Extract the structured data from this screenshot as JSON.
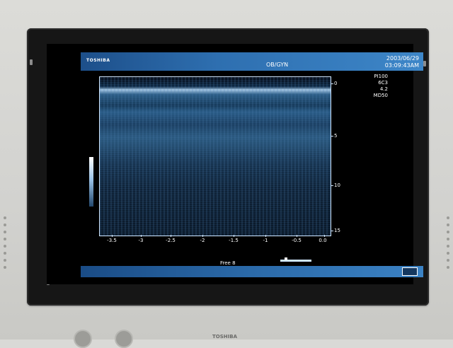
{
  "device": {
    "brand_top": "TOSHIBA",
    "exam_preset": "OB/GYN",
    "date": "2003/06/29",
    "time": "03:09:43AM",
    "params": [
      "PI100",
      "6C3",
      "4.2",
      "MD50"
    ]
  },
  "scale": {
    "depth_labels": [
      "0",
      "5",
      "10",
      "15"
    ],
    "x_labels": [
      "-3.5",
      "-3",
      "-2.5",
      "-2",
      "-1.5",
      "-1",
      "-0.5",
      "0.0"
    ]
  },
  "footer": {
    "free_label": "Free 8",
    "icon_name": "menu-grid-icon"
  },
  "bottom_brand": "TOSHIBA"
}
